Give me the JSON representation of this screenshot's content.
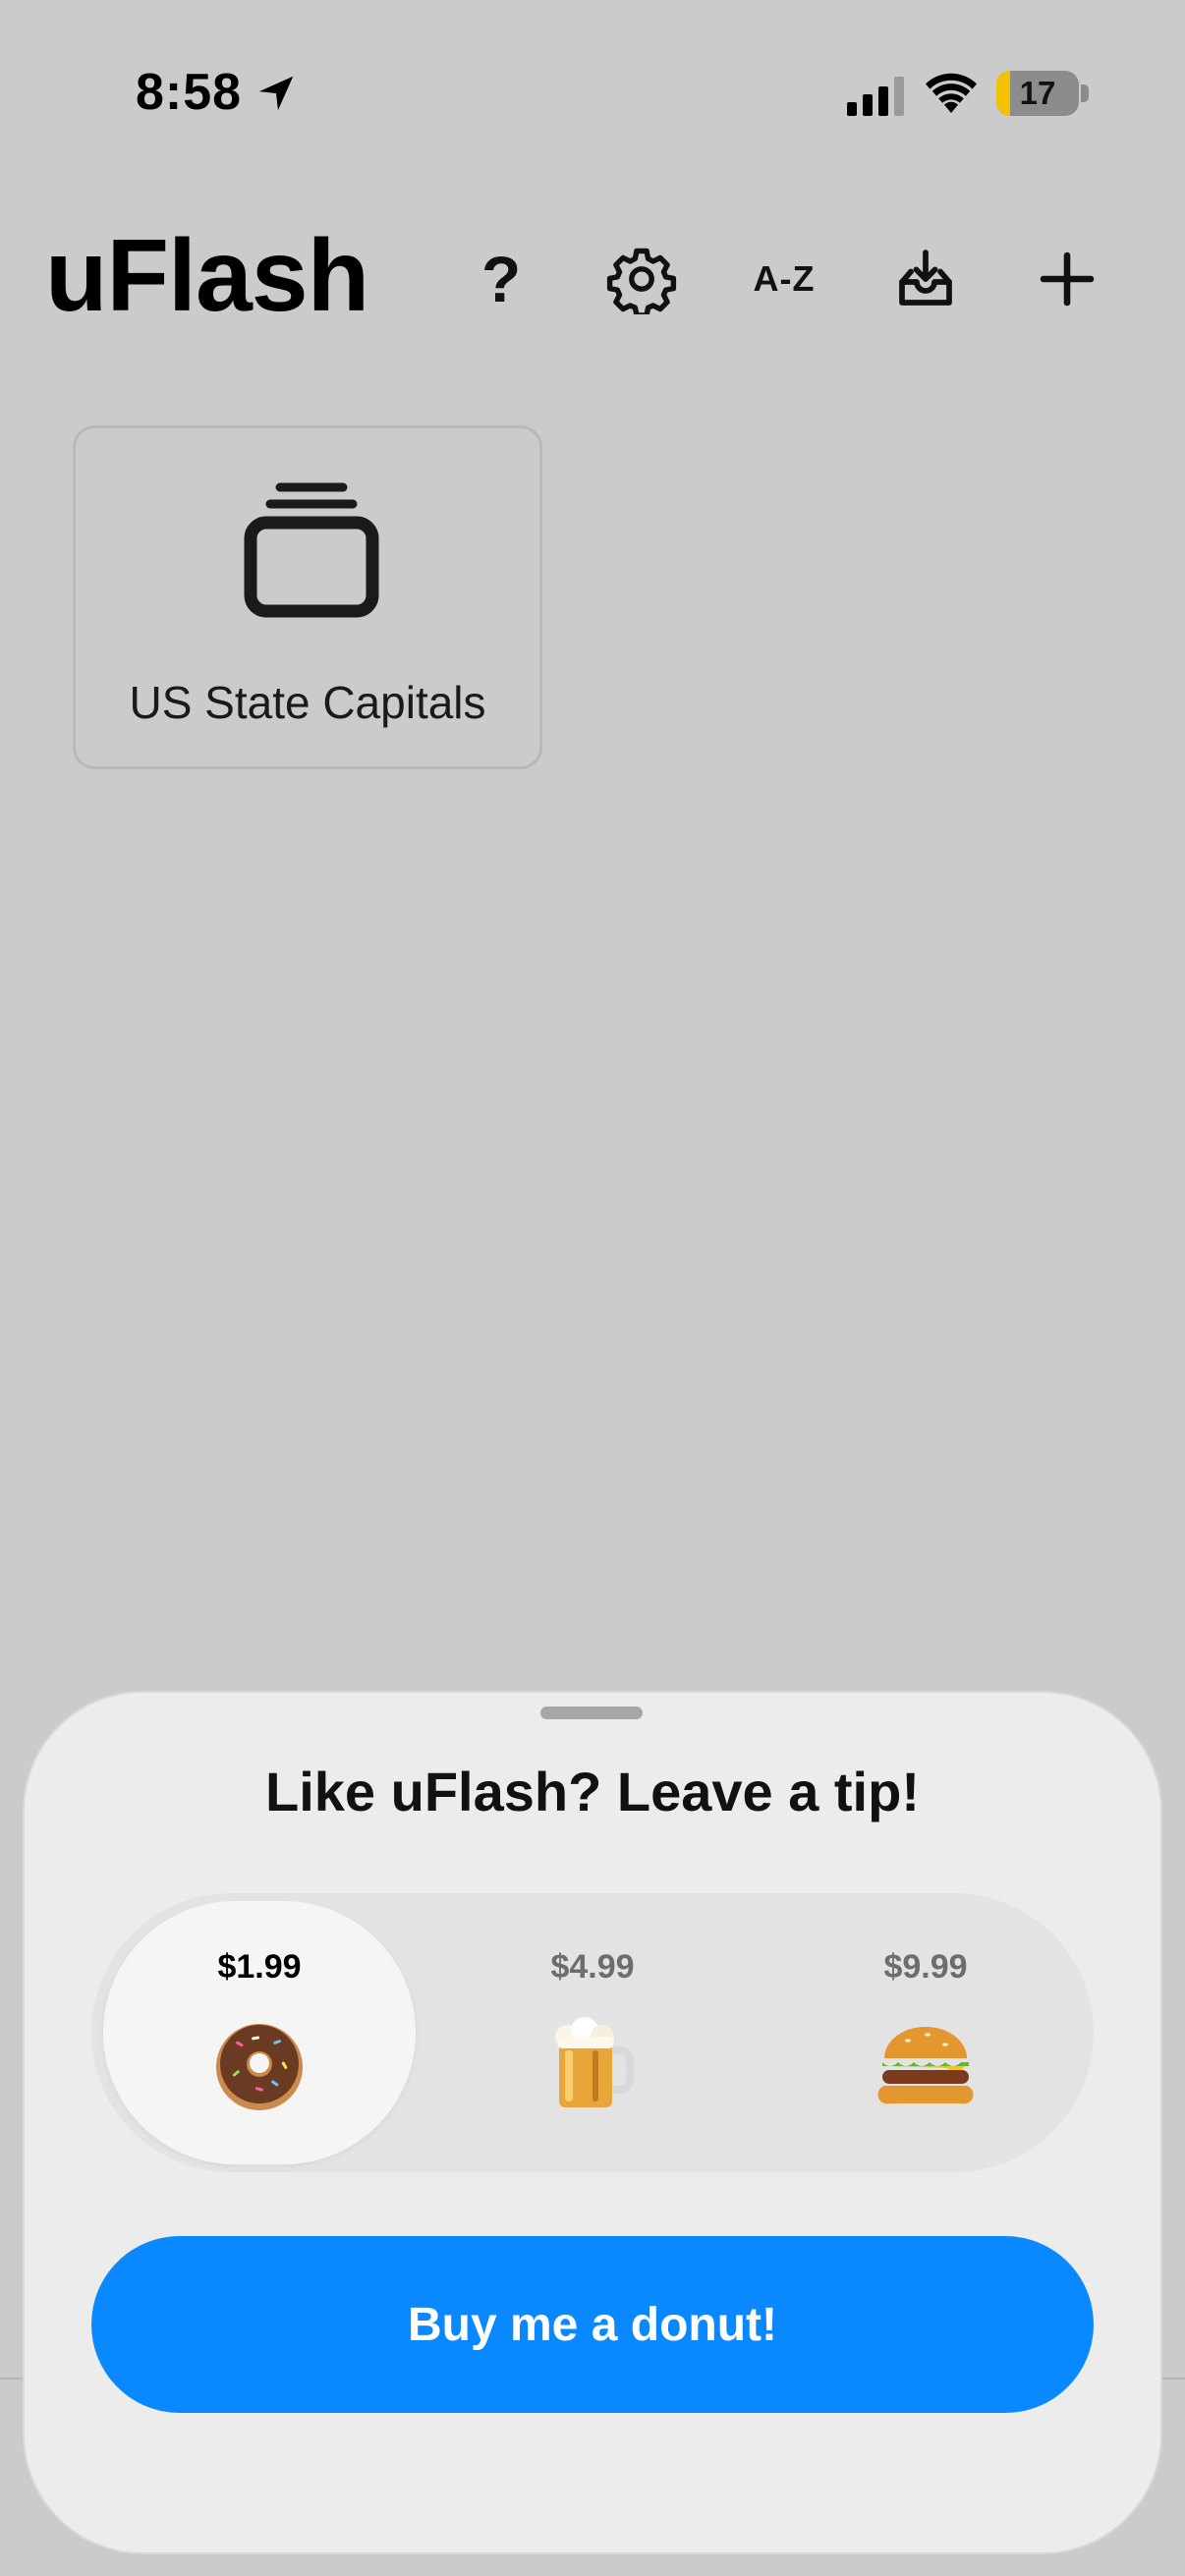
{
  "status_bar": {
    "time": "8:58",
    "battery_level": "17",
    "battery_fraction": 0.17,
    "battery_color": "#f2c200"
  },
  "header": {
    "title": "uFlash",
    "help_label": "?",
    "sort_label": "A-Z",
    "icons": [
      "question-mark",
      "gear-icon",
      "sort-az",
      "tray-download-icon",
      "plus-icon"
    ]
  },
  "decks": [
    {
      "name": "US State Capitals",
      "icon": "stack-icon"
    }
  ],
  "tip_sheet": {
    "title": "Like uFlash? Leave a tip!",
    "options": [
      {
        "price": "$1.99",
        "emoji": "donut",
        "selected": true
      },
      {
        "price": "$4.99",
        "emoji": "beer-mug",
        "selected": false
      },
      {
        "price": "$9.99",
        "emoji": "hamburger",
        "selected": false
      }
    ],
    "button_label": "Buy me a donut!",
    "button_color": "#0a88ff"
  }
}
